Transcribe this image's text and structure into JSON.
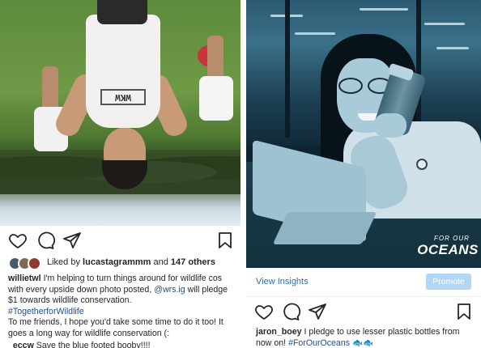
{
  "left_post": {
    "liked_by_prefix": "Liked by",
    "liked_by_user": "lucastagrammm",
    "liked_by_and": "and",
    "liked_by_count": "147 others",
    "caption": {
      "username": "willietwl",
      "line1_pre": " I'm helping to turn things around for wildlife cos with every upside down photo posted, ",
      "mention": "@wrs.ig",
      "line1_post": " will pledge $1 towards wildlife conservation.",
      "hashtag": "#TogetherforWildlife",
      "line2": "To me friends, I hope you'd take some time to do it too! It goes a long way for wildlife conservation (:",
      "comment_username": "_eccw",
      "comment_text": " Save the blue footed booby!!!!"
    },
    "shirt_print": "WKW"
  },
  "right_post": {
    "brand_small": "FOR OUR",
    "brand_big": "OCEANS",
    "view_insights": "View Insights",
    "promote": "Promote",
    "caption": {
      "username": "jaron_boey",
      "text": " I pledge to use lesser plastic bottles from now on! ",
      "hashtag": "#ForOurOceans",
      "emoji": " 🐟🐟"
    }
  },
  "colors": {
    "link": "#1f4f8c",
    "insights": "#2f6fa6",
    "promote_bg": "#b2d6f5"
  },
  "icons": [
    "heart-icon",
    "comment-icon",
    "share-icon",
    "bookmark-icon"
  ]
}
